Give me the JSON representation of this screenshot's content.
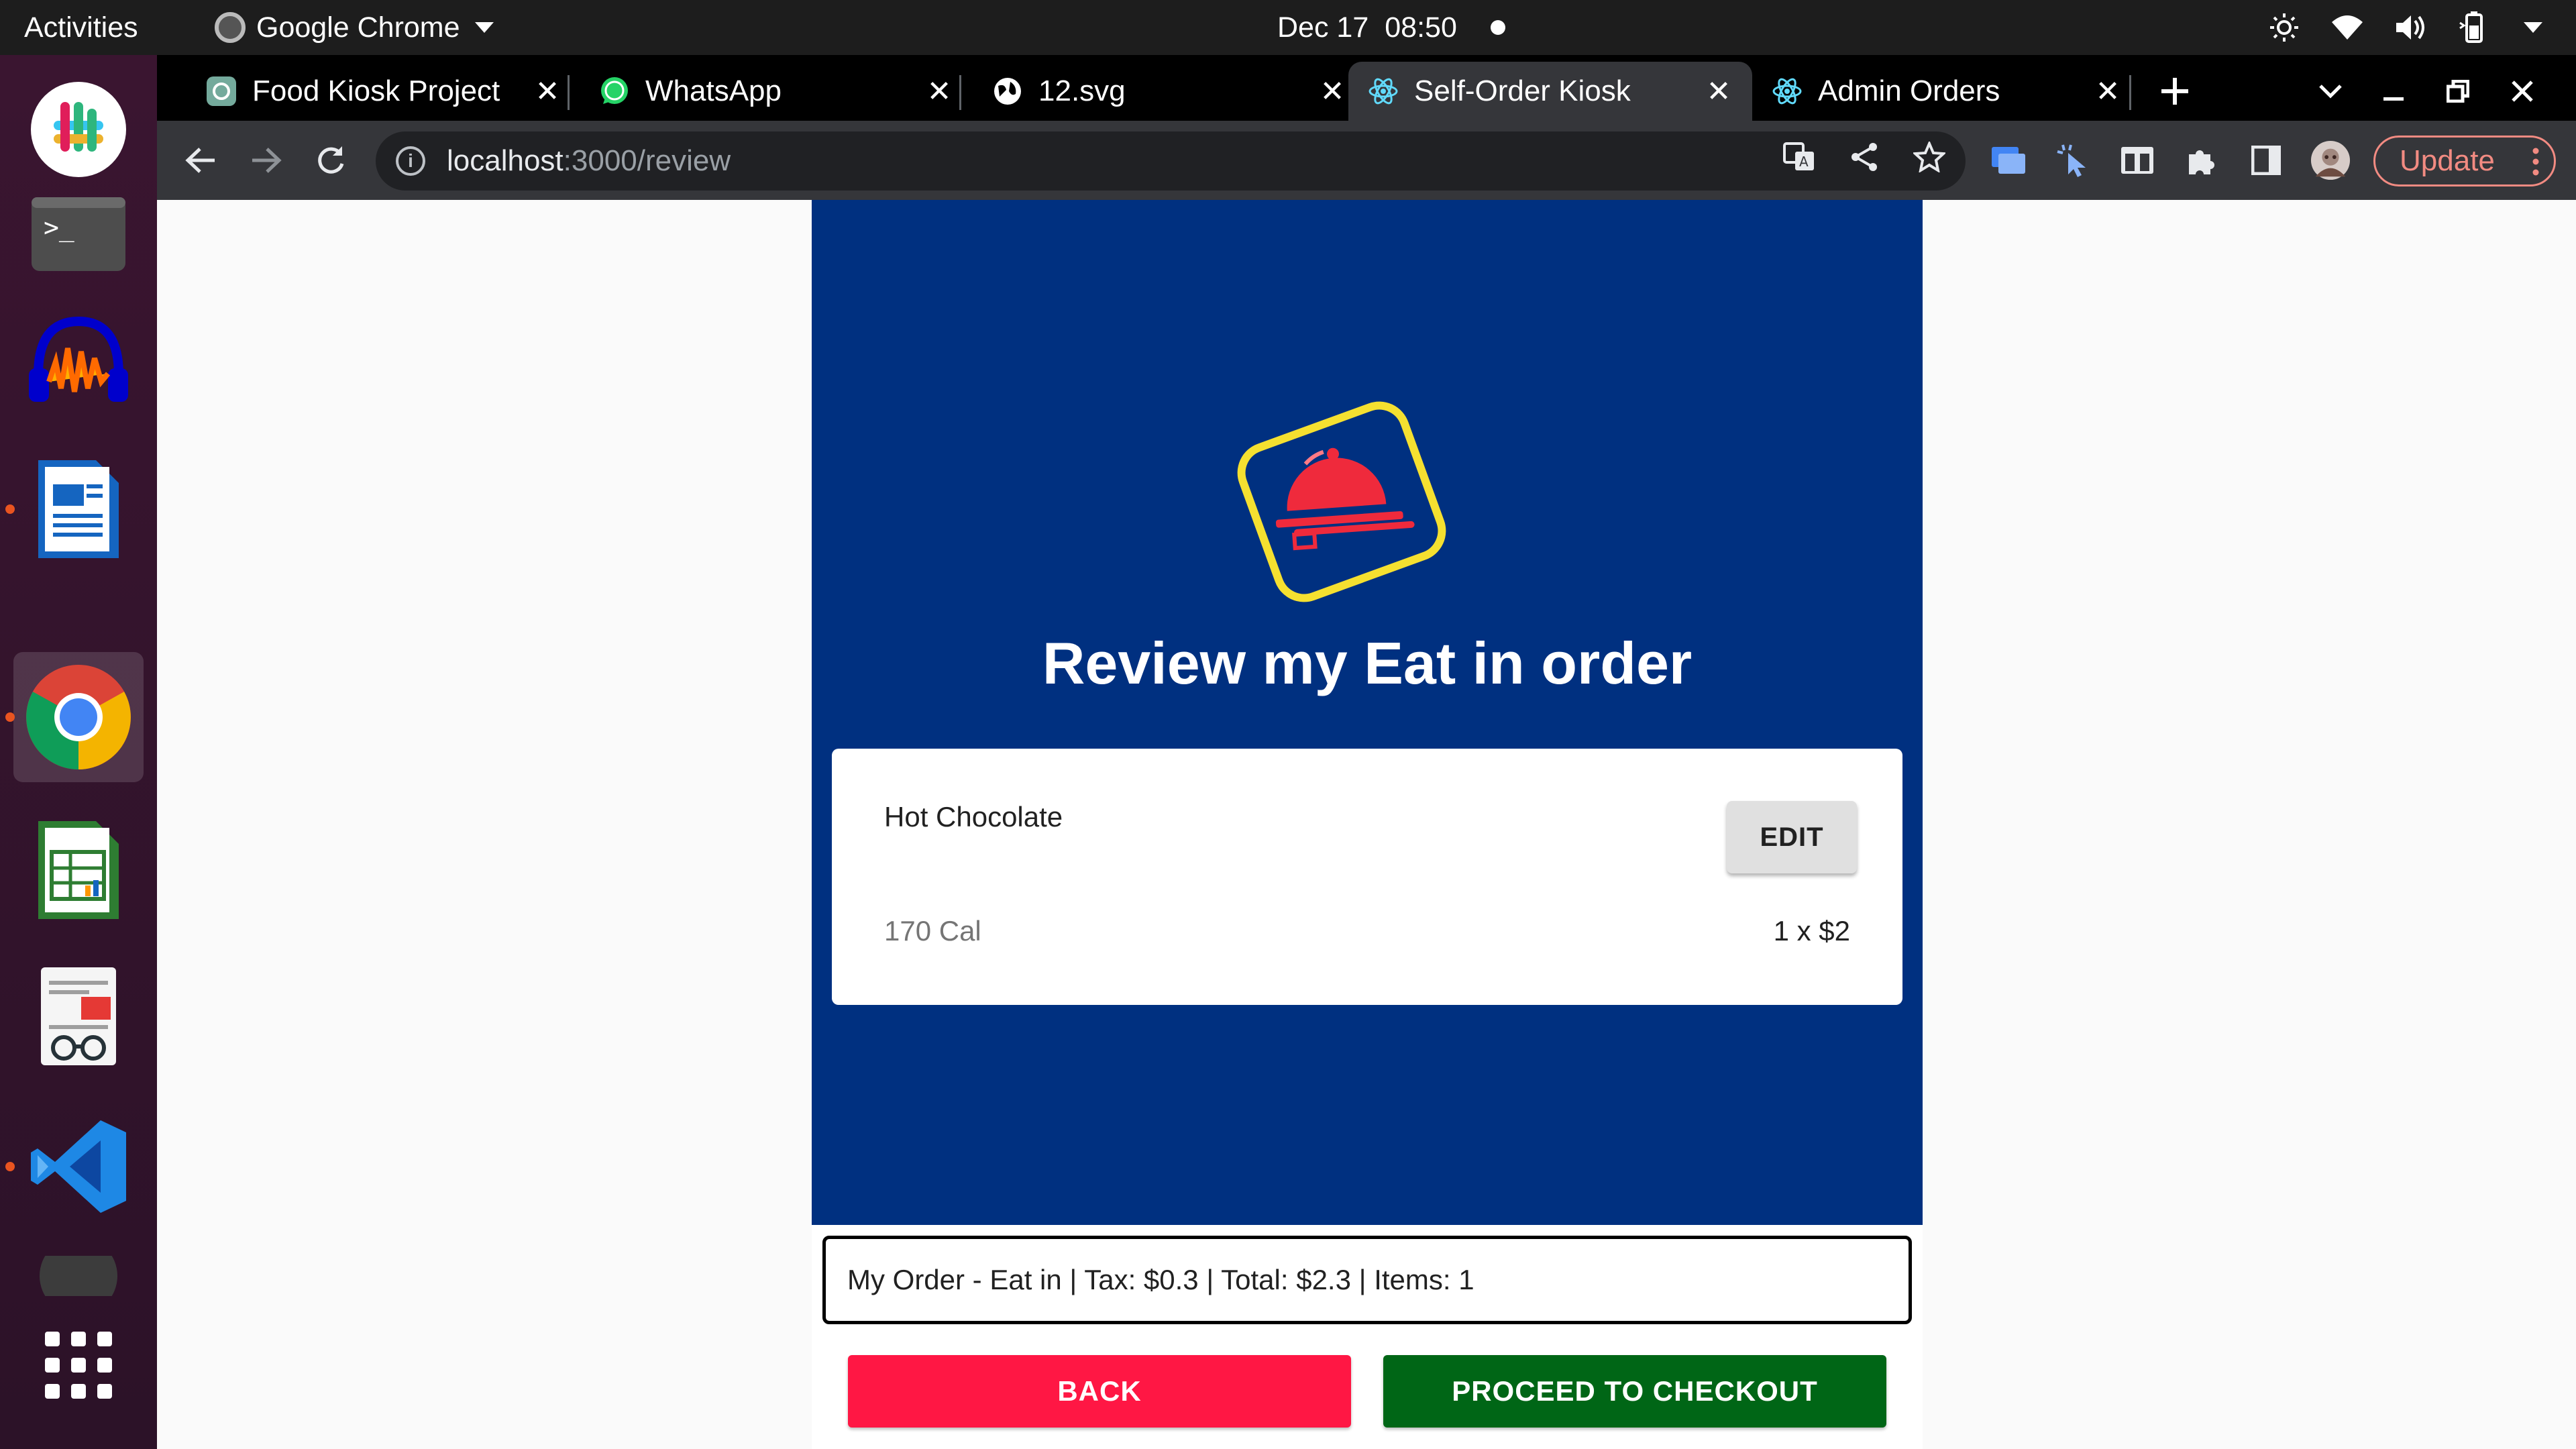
{
  "topbar": {
    "activities": "Activities",
    "app_name": "Google Chrome",
    "date": "Dec 17",
    "time": "08:50",
    "icons": [
      "brightness-icon",
      "wifi-icon",
      "volume-icon",
      "battery-icon",
      "menu-caret-icon"
    ]
  },
  "dock": {
    "items": [
      "slack",
      "terminal",
      "audacity",
      "libreoffice-writer",
      "google-chrome",
      "libreoffice-calc",
      "document-viewer",
      "vscode",
      "show-apps"
    ]
  },
  "tabs": [
    {
      "title": "Food Kiosk Project",
      "icon": "openai-icon",
      "active": false
    },
    {
      "title": "WhatsApp",
      "icon": "whatsapp-icon",
      "active": false
    },
    {
      "title": "12.svg",
      "icon": "globe-icon",
      "active": false
    },
    {
      "title": "Self-Order Kiosk",
      "icon": "react-icon",
      "active": true
    },
    {
      "title": "Admin Orders",
      "icon": "react-icon",
      "active": false
    }
  ],
  "tab_close_glyph": "✕",
  "toolbar": {
    "url_host": "localhost",
    "url_path": ":3000/review",
    "update_label": "Update"
  },
  "page": {
    "title": "Review my Eat in order",
    "items": [
      {
        "name": "Hot Chocolate",
        "calories": "170 Cal",
        "qty_price": "1 x $2",
        "edit_label": "EDIT"
      }
    ],
    "summary": "My Order - Eat in | Tax: $0.3 | Total: $2.3 | Items: 1",
    "back_label": "BACK",
    "checkout_label": "PROCEED TO CHECKOUT"
  },
  "colors": {
    "hero_bg": "#003080",
    "logo_yellow": "#f5e030",
    "logo_red": "#ef2a3c",
    "back_btn": "#ff1744",
    "checkout_btn": "#006616",
    "update_accent": "#f28b82"
  }
}
